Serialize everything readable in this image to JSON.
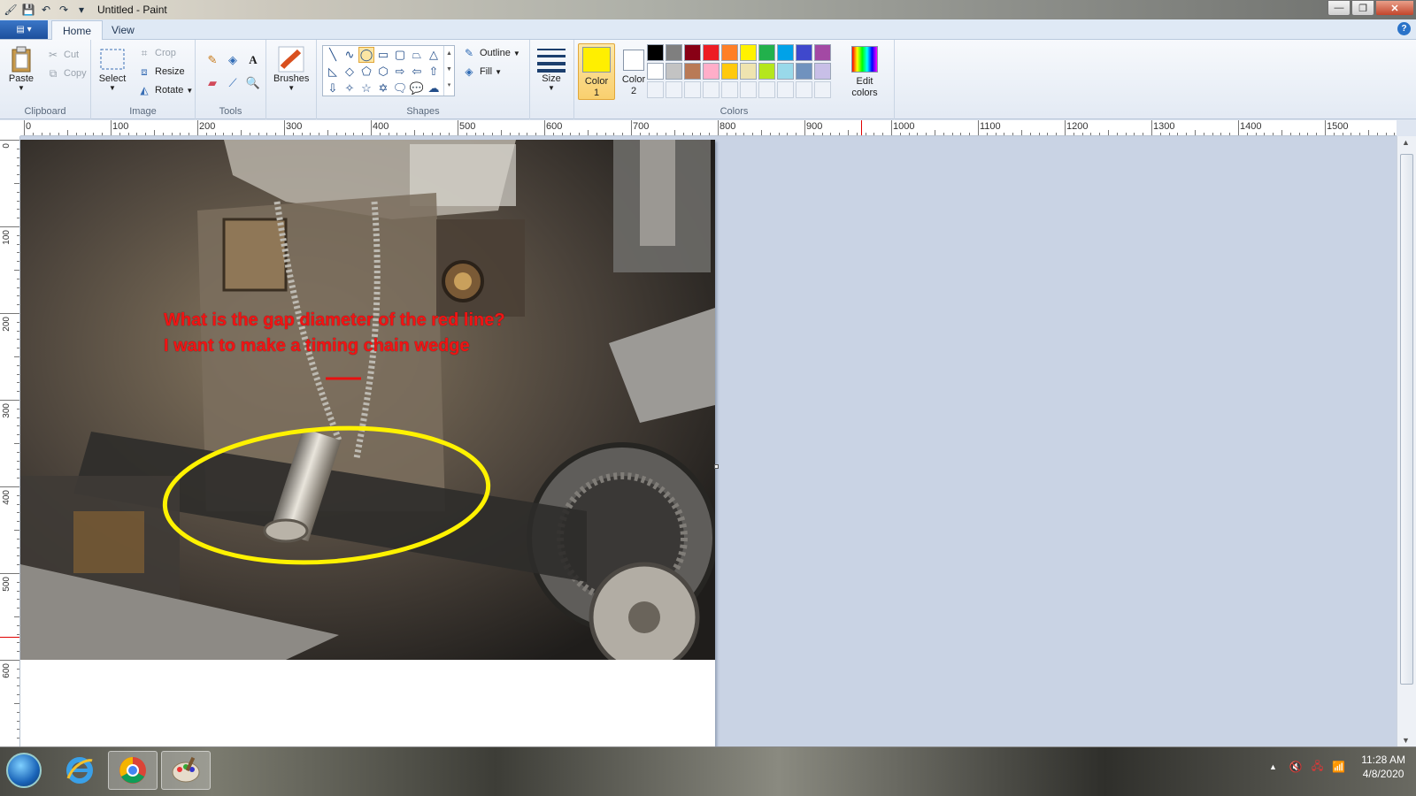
{
  "window": {
    "title": "Untitled - Paint",
    "minimize": "—",
    "restore": "❐",
    "close": "✕"
  },
  "tabs": {
    "home": "Home",
    "view": "View",
    "menu_glyph": "▤ ▾",
    "help": "?"
  },
  "ribbon": {
    "clipboard": {
      "label": "Clipboard",
      "paste": "Paste",
      "cut": "Cut",
      "copy": "Copy"
    },
    "image": {
      "label": "Image",
      "select": "Select",
      "crop": "Crop",
      "resize": "Resize",
      "rotate": "Rotate"
    },
    "tools": {
      "label": "Tools"
    },
    "brushes": {
      "label": "Brushes"
    },
    "shapes": {
      "label": "Shapes",
      "outline": "Outline",
      "fill": "Fill"
    },
    "size": {
      "label": "Size"
    },
    "colors": {
      "label": "Colors",
      "color1": "Color 1",
      "color2": "Color 2",
      "edit": "Edit colors",
      "color1_value": "#ffef00",
      "color2_value": "#ffffff",
      "palette_row1": [
        "#000000",
        "#7f7f7f",
        "#880015",
        "#ed1c24",
        "#ff7f27",
        "#fff200",
        "#22b14c",
        "#00a2e8",
        "#3f48cc",
        "#a349a4"
      ],
      "palette_row2": [
        "#ffffff",
        "#c3c3c3",
        "#b97a57",
        "#ffaec9",
        "#ffc90e",
        "#efe4b0",
        "#b5e61d",
        "#99d9ea",
        "#7092be",
        "#c8bfe7"
      ]
    }
  },
  "ruler": {
    "h_labels": [
      "0",
      "100",
      "200",
      "300",
      "400",
      "500",
      "600",
      "700",
      "800",
      "900",
      "1000",
      "1100",
      "1200",
      "1300",
      "1400",
      "1500"
    ],
    "v_labels": [
      "0",
      "100",
      "200",
      "300",
      "400",
      "500",
      "600"
    ]
  },
  "canvas": {
    "annotation_line1": "What is the gap diameter of the red line?",
    "annotation_line2": "I want to make a timing chain wedge"
  },
  "taskbar": {
    "time": "11:28 AM",
    "date": "4/8/2020"
  }
}
